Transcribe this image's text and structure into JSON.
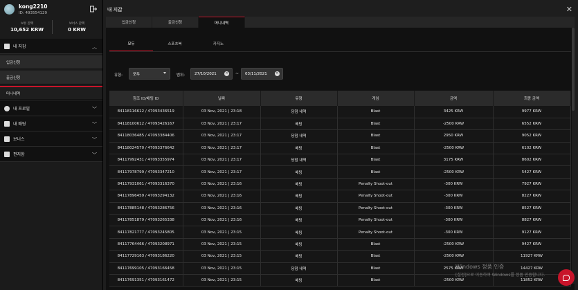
{
  "profile": {
    "username": "kong2210",
    "user_id": "ID: 493554129",
    "balance_label": "보유 잔액",
    "balance_value": "10,652 KRW",
    "bonus_label": "보너스 잔액",
    "bonus_value": "0 KRW"
  },
  "sidebar": {
    "wallet": "내 지갑",
    "deposit": "입금신청",
    "withdraw": "출금신청",
    "history": "머니내역",
    "profile": "내 프로필",
    "bets": "내 배팅",
    "bonus": "보너스",
    "messages": "편지함"
  },
  "main": {
    "title": "내 지갑",
    "tabs": [
      "입금신청",
      "출금신청",
      "머니내역"
    ],
    "subtabs": [
      "모두",
      "스포츠북",
      "카지노"
    ],
    "filter": {
      "type_label": "유형:",
      "type_value": "모두",
      "range_label": "범위:",
      "date_from": "27/10/2021",
      "date_to": "03/11/2021",
      "separator": "~"
    }
  },
  "table": {
    "headers": [
      "참조 ID/배팅 ID",
      "날짜",
      "유형",
      "게임",
      "금액",
      "최종 금액"
    ],
    "rows": [
      [
        "84118116612 / 47093436519",
        "03 Nov, 2021 | 23:18",
        "당첨 내역",
        "Blast",
        "3425 KRW",
        "9977 KRW"
      ],
      [
        "84118100612 / 47093426167",
        "03 Nov, 2021 | 23:17",
        "배팅",
        "Blast",
        "-2500 KRW",
        "6552 KRW"
      ],
      [
        "84118036485 / 47093384406",
        "03 Nov, 2021 | 23:17",
        "당첨 내역",
        "Blast",
        "2950 KRW",
        "9052 KRW"
      ],
      [
        "84118024570 / 47093376642",
        "03 Nov, 2021 | 23:17",
        "배팅",
        "Blast",
        "-2500 KRW",
        "6102 KRW"
      ],
      [
        "84117992431 / 47093355974",
        "03 Nov, 2021 | 23:17",
        "당첨 내역",
        "Blast",
        "3175 KRW",
        "8602 KRW"
      ],
      [
        "84117978799 / 47093347210",
        "03 Nov, 2021 | 23:17",
        "배팅",
        "Blast",
        "-2500 KRW",
        "5427 KRW"
      ],
      [
        "84117931061 / 47093316370",
        "03 Nov, 2021 | 23:16",
        "배팅",
        "Penalty Shoot-out",
        "-300 KRW",
        "7927 KRW"
      ],
      [
        "84117896459 / 47093294132",
        "03 Nov, 2021 | 23:16",
        "배팅",
        "Penalty Shoot-out",
        "-300 KRW",
        "8227 KRW"
      ],
      [
        "84117885148 / 47093286756",
        "03 Nov, 2021 | 23:16",
        "배팅",
        "Penalty Shoot-out",
        "-300 KRW",
        "8527 KRW"
      ],
      [
        "84117851879 / 47093265338",
        "03 Nov, 2021 | 23:16",
        "배팅",
        "Penalty Shoot-out",
        "-300 KRW",
        "8827 KRW"
      ],
      [
        "84117821777 / 47093245805",
        "03 Nov, 2021 | 23:15",
        "배팅",
        "Penalty Shoot-out",
        "-300 KRW",
        "9127 KRW"
      ],
      [
        "84117764466 / 47093208971",
        "03 Nov, 2021 | 23:15",
        "배팅",
        "Blast",
        "-2500 KRW",
        "9427 KRW"
      ],
      [
        "84117729163 / 47093186220",
        "03 Nov, 2021 | 23:15",
        "배팅",
        "Blast",
        "-2500 KRW",
        "11927 KRW"
      ],
      [
        "84117699105 / 47093166458",
        "03 Nov, 2021 | 23:15",
        "당첨 내역",
        "Blast",
        "2575 KRW",
        "14427 KRW"
      ],
      [
        "84117691351 / 47093161472",
        "03 Nov, 2021 | 23:15",
        "배팅",
        "Blast",
        "-2500 KRW",
        "11852 KRW"
      ]
    ]
  },
  "watermark": {
    "line1": "Windows 정품 인증",
    "line2": "[설정]으로 이동하여 Windows를 정품 인증합니다."
  },
  "colors": {
    "accent": "#c8142a"
  }
}
